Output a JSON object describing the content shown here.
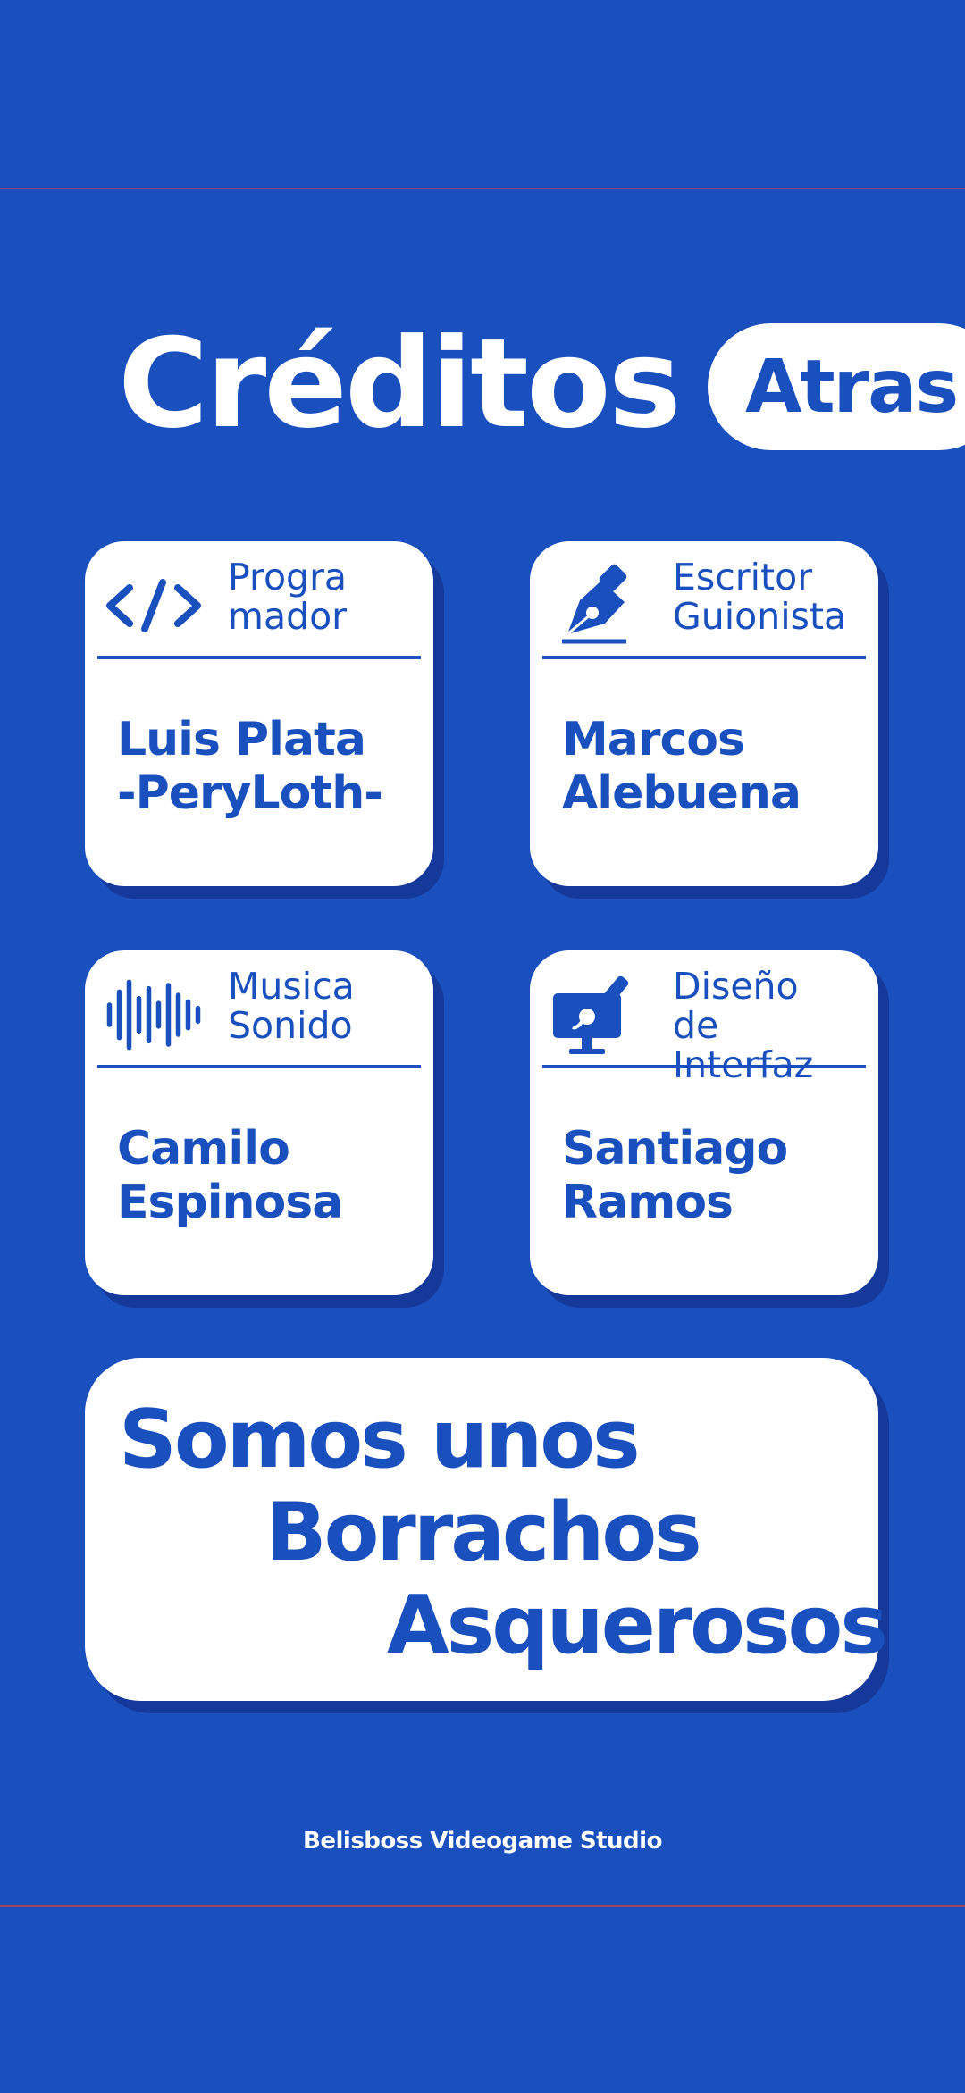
{
  "colors": {
    "background": "#1a50be",
    "card": "#ffffff",
    "accent": "#1a50be",
    "shadow": "#14399a"
  },
  "header": {
    "title": "Créditos",
    "back_label": "Atras"
  },
  "credits": [
    {
      "icon": "code-icon",
      "role_line1": "Progra",
      "role_line2": "mador",
      "name": "Luis Plata\n-PeryLoth-"
    },
    {
      "icon": "pen-nib-icon",
      "role_line1": "Escritor",
      "role_line2": "Guionista",
      "name": "Marcos\nAlebuena"
    },
    {
      "icon": "sound-wave-icon",
      "role_line1": "Musica",
      "role_line2": "Sonido",
      "name": "Camilo\nEspinosa"
    },
    {
      "icon": "monitor-brush-icon",
      "role_line1": "Diseño de",
      "role_line2": "Interfaz",
      "name": "Santiago\nRamos"
    }
  ],
  "slogan": {
    "line1": "Somos unos",
    "line2": "Borrachos",
    "line3": "Asquerosos"
  },
  "footer": {
    "studio": "Belisboss Videogame Studio"
  }
}
